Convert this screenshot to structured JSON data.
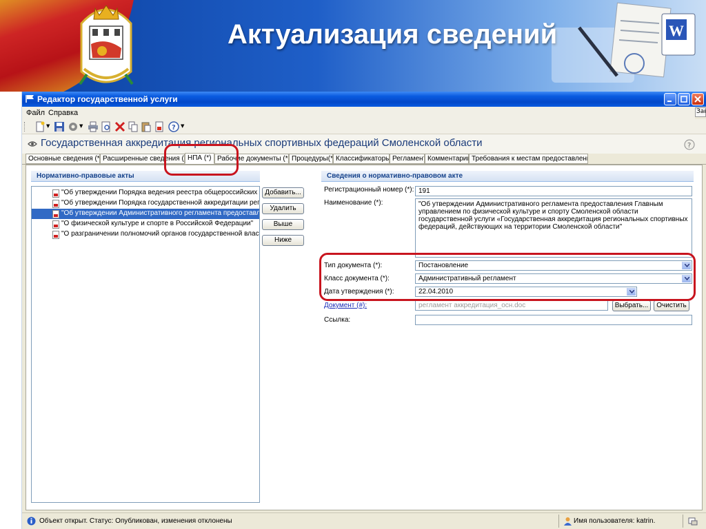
{
  "slide": {
    "title": "Актуализация сведений",
    "coat_of_arms_icon": "coat-of-arms-icon",
    "decoration_icon": "document-word-icon"
  },
  "window": {
    "title": "Редактор государственной услуги",
    "offscreen_label": "Зак"
  },
  "menu": {
    "items": [
      "Файл",
      "Справка"
    ]
  },
  "toolbar": {
    "icons": [
      "new-document-icon",
      "save-icon",
      "settings-icon",
      "print-icon",
      "preview-icon",
      "delete-icon",
      "copy-icon",
      "paste-icon",
      "export-icon",
      "help-icon"
    ]
  },
  "service": {
    "title": "Государственная аккредитация региональных спортивных федераций Смоленской области"
  },
  "tabs": [
    {
      "label": "Основные сведения (*)"
    },
    {
      "label": "Расширенные сведения (*)"
    },
    {
      "label": "НПА (*)"
    },
    {
      "label": "Рабочие документы (*)"
    },
    {
      "label": "Процедуры(*)"
    },
    {
      "label": "Классификаторы"
    },
    {
      "label": "Регламент"
    },
    {
      "label": "Комментарии"
    },
    {
      "label": "Требования к местам предоставления"
    }
  ],
  "active_tab": "НПА (*)",
  "npa_panel": {
    "header": "Нормативно-правовые акты",
    "items": [
      "\"Об утверждении Порядка ведения реестра общероссийских и ...",
      "\"Об утверждении Порядка государственной аккредитации реги",
      "\"Об утверждении Административного регламента предоставле",
      "\"О физической культуре и спорте в Российской Федерации\"",
      "\"О разграничении полномочий органов государственной власти"
    ],
    "selected_index": 2,
    "buttons": {
      "add": "Добавить...",
      "delete": "Удалить",
      "up": "Выше",
      "down": "Ниже"
    }
  },
  "details_panel": {
    "header": "Сведения о нормативно-правовом акте",
    "reg_number": {
      "label": "Регистрационный номер (*):",
      "value": "191"
    },
    "name": {
      "label": "Наименование (*):",
      "value": "\"Об утверждении Административного регламента предоставления Главным управлением по физической культуре и спорту Смоленской области государственной услуги «Государственная аккредитация региональных спортивных федераций, действующих на территории Смоленской области\""
    },
    "doc_type": {
      "label": "Тип документа (*):",
      "value": "Постановление"
    },
    "doc_class": {
      "label": "Класс документа (*):",
      "value": "Административный регламент"
    },
    "approval_date": {
      "label": "Дата утверждения (*):",
      "value": "22.04.2010"
    },
    "document": {
      "label": "Документ (#):",
      "value": "регламент аккредитация_осн.doc",
      "choose": "Выбрать...",
      "clear": "Очистить"
    },
    "link": {
      "label": "Ссылка:",
      "value": ""
    }
  },
  "status": {
    "text": "Объект открыт. Статус: Опубликован, изменения отклонены",
    "user": "Имя пользователя: katrin."
  },
  "colors": {
    "highlight": "#c8141e",
    "selection": "#316ac5",
    "title_text": "#1a3b7a"
  }
}
